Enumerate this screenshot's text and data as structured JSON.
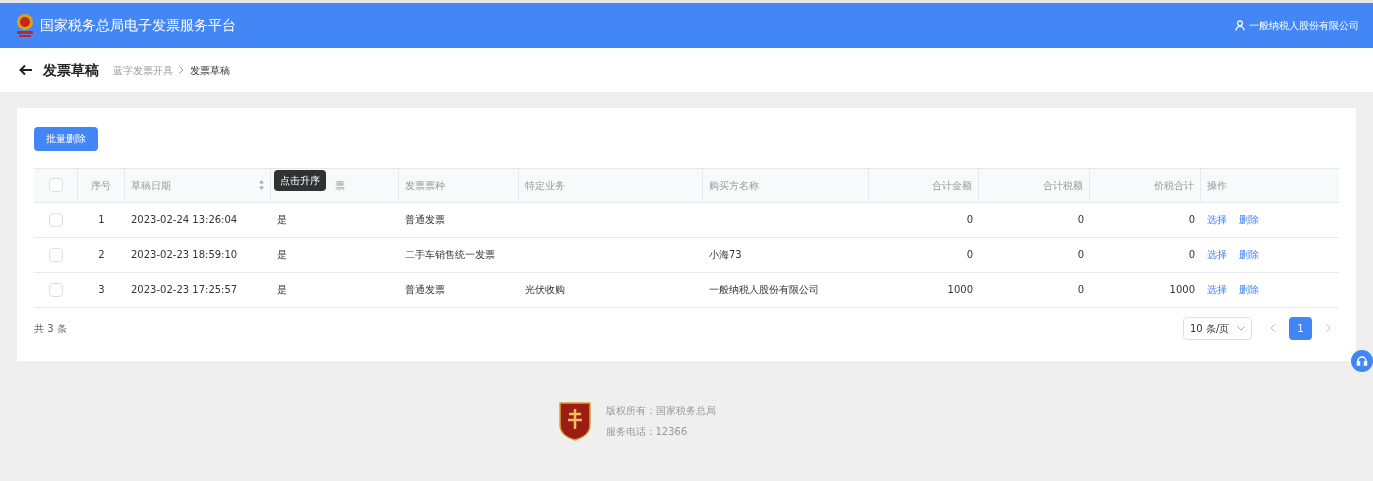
{
  "header": {
    "title": "国家税务总局电子发票服务平台",
    "user": "一般纳税人股份有限公司"
  },
  "page": {
    "title": "发票草稿",
    "breadcrumb": [
      {
        "label": "蓝字发票开具",
        "current": false
      },
      {
        "label": "发票草稿",
        "current": true
      }
    ]
  },
  "toolbar": {
    "batch_delete": "批量删除"
  },
  "table": {
    "select_all_checked": false,
    "columns": [
      {
        "label": "序号",
        "sortable": false
      },
      {
        "label": "草稿日期",
        "sortable": true
      },
      {
        "label": "票",
        "sortable": false
      },
      {
        "label": "发票票种",
        "sortable": false
      },
      {
        "label": "特定业务",
        "sortable": false
      },
      {
        "label": "购买方名称",
        "sortable": false
      },
      {
        "label": "合计金额",
        "sortable": false
      },
      {
        "label": "合计税额",
        "sortable": false
      },
      {
        "label": "价税合计",
        "sortable": false
      },
      {
        "label": "操作",
        "sortable": false
      }
    ],
    "tooltip": "点击升序",
    "rows": [
      {
        "checked": false,
        "cells": [
          "1",
          "2023-02-24 13:26:04",
          "是",
          "普通发票",
          "",
          "",
          "0",
          "0",
          "0"
        ],
        "actions": [
          "选择",
          "删除"
        ]
      },
      {
        "checked": false,
        "cells": [
          "2",
          "2023-02-23 18:59:10",
          "是",
          "二手车销售统一发票",
          "",
          "小海73",
          "0",
          "0",
          "0"
        ],
        "actions": [
          "选择",
          "删除"
        ]
      },
      {
        "checked": false,
        "cells": [
          "3",
          "2023-02-23 17:25:57",
          "是",
          "普通发票",
          "光伏收购",
          "一般纳税人股份有限公司",
          "1000",
          "0",
          "1000"
        ],
        "actions": [
          "选择",
          "删除"
        ]
      }
    ]
  },
  "pagination": {
    "total": "共 3 条",
    "page_size": "10 条/页",
    "pages": [
      {
        "label": "1",
        "selected": true
      }
    ]
  },
  "footer": {
    "copyright": "版权所有：国家税务总局",
    "phone": "服务电话：12366"
  }
}
